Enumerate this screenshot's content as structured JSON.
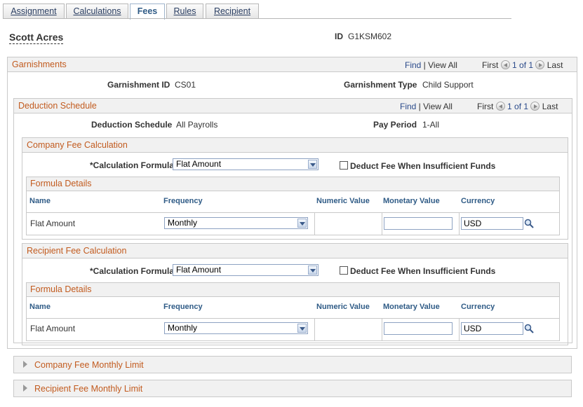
{
  "tabs": [
    "Assignment",
    "Calculations",
    "Fees",
    "Rules",
    "Recipient"
  ],
  "employee": {
    "name": "Scott Acres",
    "id_label": "ID",
    "id_value": "G1KSM602"
  },
  "garnishments": {
    "title": "Garnishments",
    "find": "Find",
    "view_all": "View All",
    "first": "First",
    "pager": "1 of 1",
    "last": "Last",
    "garnishment_id_label": "Garnishment ID",
    "garnishment_id": "CS01",
    "garnishment_type_label": "Garnishment Type",
    "garnishment_type": "Child Support"
  },
  "deduction": {
    "title": "Deduction Schedule",
    "find": "Find",
    "view_all": "View All",
    "first": "First",
    "pager": "1 of 1",
    "last": "Last",
    "schedule_label": "Deduction Schedule",
    "schedule_value": "All Payrolls",
    "pay_period_label": "Pay Period",
    "pay_period_value": "1-All"
  },
  "company_fee": {
    "title": "Company Fee Calculation",
    "formula_label": "*Calculation Formula",
    "formula_value": "Flat Amount",
    "deduct_label": "Deduct Fee When Insufficient Funds",
    "details_title": "Formula Details",
    "columns": [
      "Name",
      "Frequency",
      "Numeric Value",
      "Monetary Value",
      "Currency"
    ],
    "row": {
      "name": "Flat Amount",
      "frequency": "Monthly",
      "numeric": "",
      "monetary": "",
      "currency": "USD"
    }
  },
  "recipient_fee": {
    "title": "Recipient Fee Calculation",
    "formula_label": "*Calculation Formula",
    "formula_value": "Flat Amount",
    "deduct_label": "Deduct Fee When Insufficient Funds",
    "details_title": "Formula Details",
    "columns": [
      "Name",
      "Frequency",
      "Numeric Value",
      "Monetary Value",
      "Currency"
    ],
    "row": {
      "name": "Flat Amount",
      "frequency": "Monthly",
      "numeric": "",
      "monetary": "",
      "currency": "USD"
    }
  },
  "collapsed": {
    "company_limit": "Company Fee Monthly Limit",
    "recipient_limit": "Recipient Fee Monthly Limit"
  },
  "colors": {
    "accent": "#c25b1f",
    "link": "#2a4a8a",
    "header_text": "#2f5b86"
  }
}
